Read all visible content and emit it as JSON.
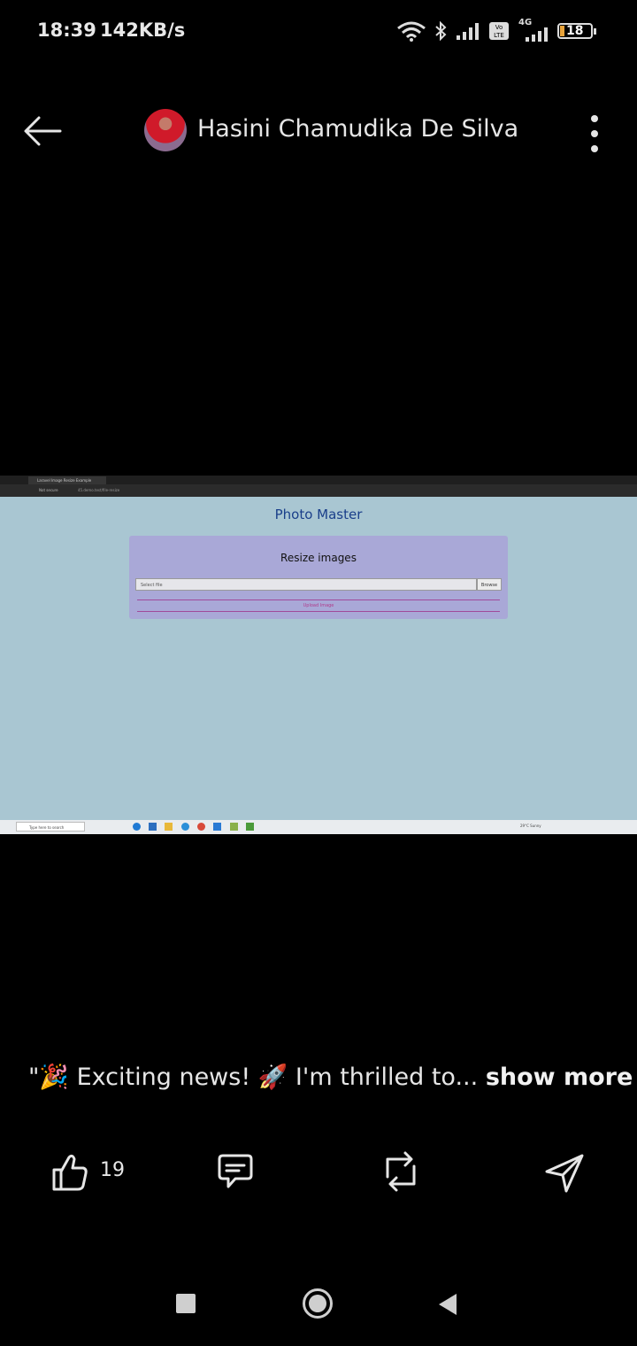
{
  "status": {
    "time": "18:39",
    "speed": "142KB/s",
    "network_label": "4G",
    "battery": "18"
  },
  "header": {
    "name": "Hasini Chamudika De Silva"
  },
  "screenshot": {
    "tab_title": "Laravel Image Resize Example",
    "address_security": "Not secure",
    "address_url": "45.demo.test/file-resize",
    "page_title": "Photo Master",
    "card_title": "Resize images",
    "file_placeholder": "Select file",
    "browse_label": "Browse",
    "upload_label": "Upload Image",
    "taskbar_search": "Type here to search",
    "weather": "29°C Sunny"
  },
  "post": {
    "caption": "\"🎉 Exciting news! 🚀 I'm thrilled to...",
    "show_more": "show more",
    "likes": "19"
  },
  "colors": {
    "background": "#000000",
    "page_bg": "#a9c6d2",
    "card_bg": "#a9a8d7",
    "title_blue": "#1a3f8a"
  }
}
